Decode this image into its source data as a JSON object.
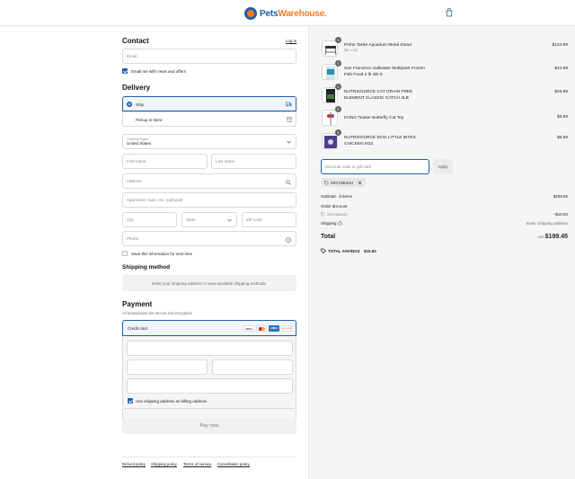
{
  "header": {
    "brand_pets": "Pets",
    "brand_warehouse": "Warehouse.",
    "cart_icon": "shopping-bag-icon"
  },
  "contact": {
    "title": "Contact",
    "login_link": "Log in",
    "email_placeholder": "Email",
    "news_checkbox_label": "Email me with news and offers",
    "news_checked": true
  },
  "delivery": {
    "title": "Delivery",
    "options": [
      {
        "label": "Ship",
        "selected": true,
        "icon": "truck-icon"
      },
      {
        "label": "Pickup in store",
        "selected": false,
        "icon": "store-icon"
      }
    ],
    "country_label": "Country/Region",
    "country_value": "United States",
    "first_name_placeholder": "First name",
    "last_name_placeholder": "Last name",
    "address_placeholder": "Address",
    "apartment_placeholder": "Apartment, suite, etc. (optional)",
    "city_placeholder": "City",
    "state_placeholder": "State",
    "zip_placeholder": "ZIP code",
    "phone_placeholder": "Phone",
    "save_info_label": "Save this information for next time",
    "save_info_checked": false
  },
  "shipping_method": {
    "title": "Shipping method",
    "message": "Enter your shipping address to view available shipping methods."
  },
  "payment": {
    "title": "Payment",
    "subtitle": "All transactions are secure and encrypted.",
    "method_label": "Credit card",
    "card_brands": [
      "VISA",
      "mastercard",
      "AMEX",
      "DISCOVER"
    ],
    "billing_label": "Use shipping address as billing address",
    "billing_checked": true,
    "pay_button": "Pay now"
  },
  "footer_links": [
    "Refund policy",
    "Shipping policy",
    "Terms of service",
    "Cancellation policy"
  ],
  "order": {
    "items": [
      {
        "qty": "1",
        "name": "Prime Tanks Aquarium Metal Stand",
        "variant": "36\" x 18\"",
        "price": "$124.99"
      },
      {
        "qty": "1",
        "name": "San Francisco Saltwater Multipack Frozen Fish Food 2 lb SD-5",
        "variant": "",
        "price": "$44.99"
      },
      {
        "qty": "1",
        "name": "NUTRISOURCE CAT GRAIN FREE ELEMENT CLASSIC CATCH 4LB",
        "variant": "",
        "price": "$26.99"
      },
      {
        "qty": "1",
        "name": "KONG Teaser Butterfly Cat Toy",
        "variant": "",
        "price": "$5.99"
      },
      {
        "qty": "1",
        "name": "NUTRISOURCE DOG LITTLE BITES CHICKEN 6OZ",
        "variant": "",
        "price": "$6.99"
      }
    ],
    "discount_placeholder": "Discount code or gift card",
    "apply_button": "Apply",
    "applied_code": "X9Y1SE4GJ",
    "subtotal_label": "Subtotal · 5 items",
    "subtotal_value": "$209.95",
    "order_discount_label": "Order discount",
    "order_discount_code": "X9Y1SE4GJ",
    "order_discount_value": "−$10.50",
    "shipping_label": "Shipping",
    "shipping_value": "Enter shipping address",
    "total_label": "Total",
    "total_currency": "USD",
    "total_value": "$199.45",
    "savings_label": "TOTAL SAVINGS",
    "savings_value": "$10.50"
  },
  "colors": {
    "brand_blue": "#1f5fa8",
    "brand_orange": "#f47b20"
  }
}
